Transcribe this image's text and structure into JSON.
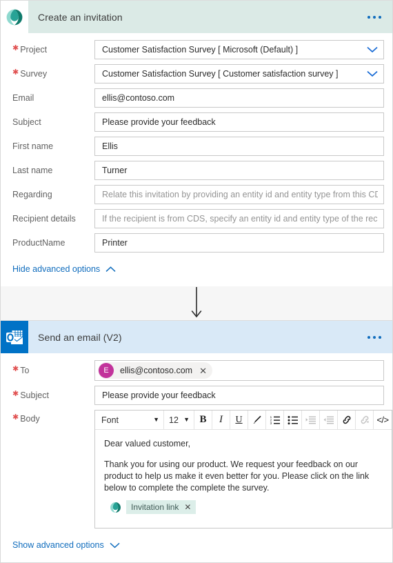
{
  "colors": {
    "header_teal": "#dbeae6",
    "header_blue": "#d9e9f7",
    "outlook_blue": "#0072c6",
    "link_blue": "#0f6cbd",
    "required_red": "#e04f4f",
    "avatar_magenta": "#c2339b",
    "token_mint": "#dceee9",
    "connector_gray": "#f6f6f6"
  },
  "cards": [
    {
      "id": "create-an-invitation",
      "title": "Create an invitation",
      "icon": "forms-pro-icon",
      "more_menu": "ellipsis-menu",
      "fields": [
        {
          "label": "Project",
          "required": true,
          "type": "dropdown",
          "value": "Customer Satisfaction Survey [ Microsoft (Default) ]",
          "placeholder": "",
          "chevron": "chevron-down-icon"
        },
        {
          "label": "Survey",
          "required": true,
          "type": "dropdown",
          "value": "Customer Satisfaction Survey [ Customer satisfaction survey ]",
          "placeholder": "",
          "chevron": "chevron-down-icon"
        },
        {
          "label": "Email",
          "required": false,
          "type": "text",
          "value": "ellis@contoso.com",
          "placeholder": ""
        },
        {
          "label": "Subject",
          "required": false,
          "type": "text",
          "value": "Please provide your feedback",
          "placeholder": ""
        },
        {
          "label": "First name",
          "required": false,
          "type": "text",
          "value": "Ellis",
          "placeholder": ""
        },
        {
          "label": "Last name",
          "required": false,
          "type": "text",
          "value": "Turner",
          "placeholder": ""
        },
        {
          "label": "Regarding",
          "required": false,
          "type": "text",
          "value": "",
          "placeholder": "Relate this invitation by providing an entity id and entity type from this CDS in t"
        },
        {
          "label": "Recipient details",
          "required": false,
          "type": "text",
          "value": "",
          "placeholder": "If the recipient is from CDS, specify an entity id and entity type of the recipient t"
        },
        {
          "label": "ProductName",
          "required": false,
          "type": "text",
          "value": "Printer",
          "placeholder": ""
        }
      ],
      "advanced_toggle": {
        "label": "Hide advanced options",
        "icon": "chevron-up-icon"
      }
    }
  ],
  "connector": {
    "icon": "arrow-down-icon"
  },
  "email_card": {
    "id": "send-an-email-v2",
    "title": "Send an email (V2)",
    "icon": "outlook-icon",
    "more_menu": "ellipsis-menu",
    "to": {
      "label": "To",
      "required": true,
      "chip": {
        "avatar_initial": "E",
        "text": "ellis@contoso.com",
        "remove_icon": "close-icon"
      }
    },
    "subject": {
      "label": "Subject",
      "required": true,
      "value": "Please provide your feedback"
    },
    "body": {
      "label": "Body",
      "required": true,
      "toolbar": {
        "font_value": "Font",
        "size_value": "12",
        "buttons": [
          {
            "name": "bold-icon",
            "glyph": "B",
            "disabled": false
          },
          {
            "name": "italic-icon",
            "glyph": "I",
            "disabled": false
          },
          {
            "name": "underline-icon",
            "glyph": "U",
            "disabled": false
          },
          {
            "name": "highlight-pen-icon",
            "glyph": "",
            "disabled": false
          },
          {
            "name": "numbered-list-icon",
            "glyph": "",
            "disabled": false
          },
          {
            "name": "bulleted-list-icon",
            "glyph": "",
            "disabled": false
          },
          {
            "name": "increase-indent-icon",
            "glyph": "",
            "disabled": true
          },
          {
            "name": "decrease-indent-icon",
            "glyph": "",
            "disabled": true
          },
          {
            "name": "insert-link-icon",
            "glyph": "",
            "disabled": false
          },
          {
            "name": "remove-link-icon",
            "glyph": "",
            "disabled": true
          },
          {
            "name": "code-view-icon",
            "glyph": "</>",
            "disabled": false
          }
        ]
      },
      "paragraphs": [
        "Dear valued customer,",
        "Thank you for using our product. We request your feedback on our product to help us make it even better for you. Please click on the link below to complete the complete the survey."
      ],
      "token": {
        "icon": "forms-pro-icon",
        "label": "Invitation link",
        "remove_icon": "close-icon"
      }
    },
    "advanced_toggle": {
      "label": "Show advanced options",
      "icon": "chevron-down-icon"
    }
  }
}
